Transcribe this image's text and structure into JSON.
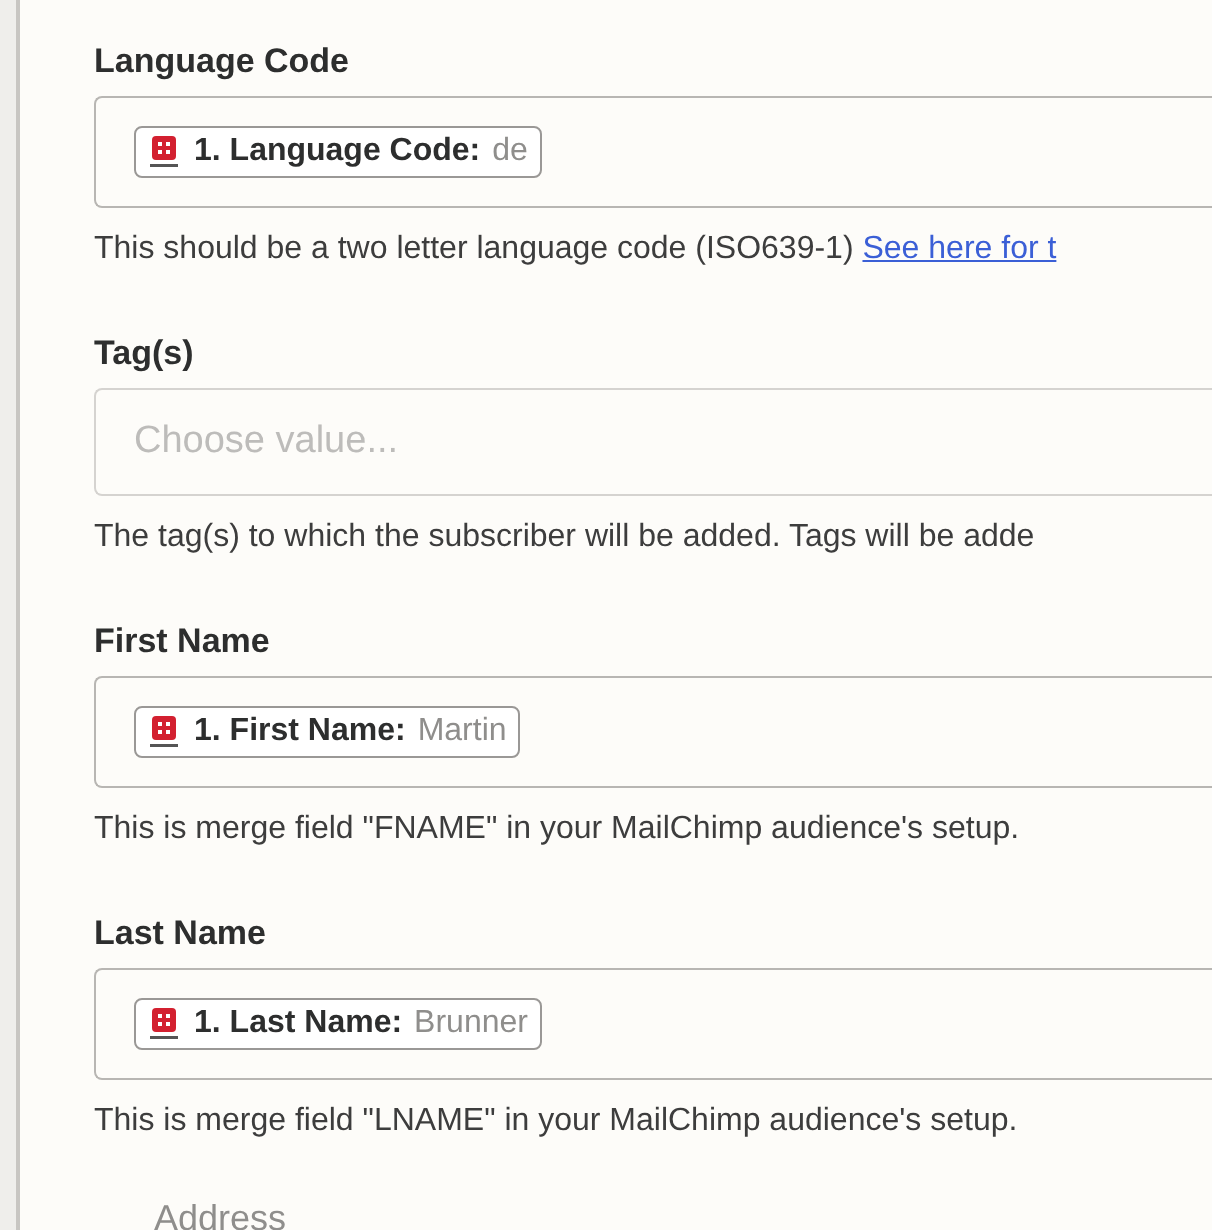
{
  "fields": [
    {
      "kind": "mapped",
      "label": "Language Code",
      "chip": {
        "step": "1. Language Code:",
        "value": "de"
      },
      "help": "This should be a two letter language code (ISO639-1)",
      "help_link": "See here for t"
    },
    {
      "kind": "select",
      "label": "Tag(s)",
      "placeholder": "Choose value...",
      "help": "The tag(s) to which the subscriber will be added. Tags will be adde"
    },
    {
      "kind": "mapped",
      "label": "First Name",
      "chip": {
        "step": "1. First Name:",
        "value": "Martin"
      },
      "help": "This is merge field \"FNAME\" in your MailChimp audience's setup."
    },
    {
      "kind": "mapped",
      "label": "Last Name",
      "chip": {
        "step": "1. Last Name:",
        "value": "Brunner"
      },
      "help": "This is merge field \"LNAME\" in your MailChimp audience's setup."
    }
  ],
  "group": {
    "label": "Address"
  }
}
